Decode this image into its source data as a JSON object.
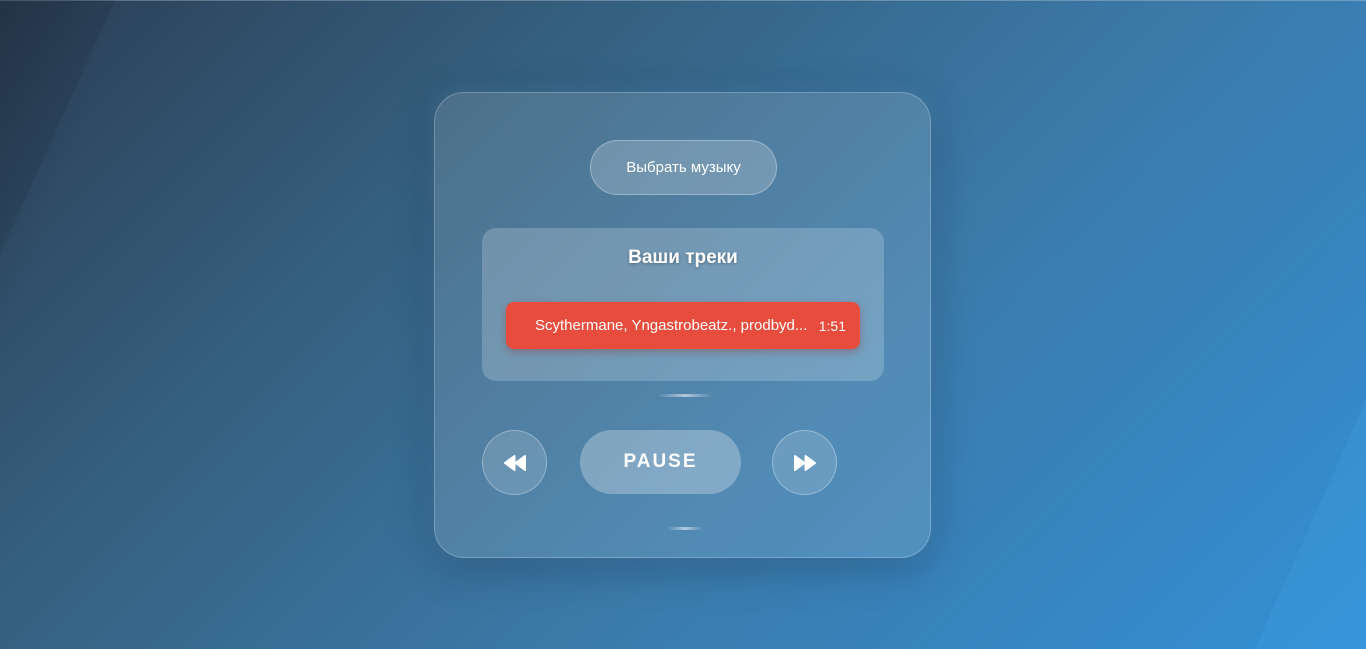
{
  "player": {
    "choose_music_label": "Выбрать музыку",
    "tracks_title": "Ваши треки",
    "tracks": [
      {
        "name": "Scythermane, Yngastrobeatz., prodbyd...",
        "duration": "1:51",
        "active": true
      }
    ],
    "controls": {
      "prev_icon": "rewind-icon",
      "pause_label": "PAUSE",
      "next_icon": "fast-forward-icon"
    }
  },
  "colors": {
    "active_track": "#e74c3c",
    "background_start": "#2c3e55",
    "background_end": "#3390d6"
  }
}
